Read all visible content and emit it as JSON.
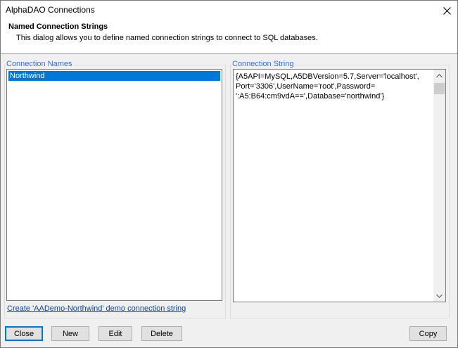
{
  "window": {
    "title": "AlphaDAO Connections"
  },
  "header": {
    "title": "Named Connection Strings",
    "description": "This dialog allows you to define named connection strings to connect to SQL databases."
  },
  "connection_names": {
    "label": "Connection Names",
    "items": [
      "Northwind"
    ],
    "selected": "Northwind"
  },
  "connection_string": {
    "label": "Connection String",
    "value": "{A5API=MySQL,A5DBVersion=5.7,Server='localhost',\nPort='3306',UserName='root',Password=\n':A5:B64:cm9vdA==',Database='northwind'}"
  },
  "demo_link": "Create 'AADemo-Northwind' demo connection string",
  "buttons": {
    "close": "Close",
    "new": "New",
    "edit": "Edit",
    "delete": "Delete",
    "copy": "Copy"
  },
  "colors": {
    "selection": "#0078d7",
    "group_label": "#3b6ed6",
    "link": "#0645ad"
  }
}
